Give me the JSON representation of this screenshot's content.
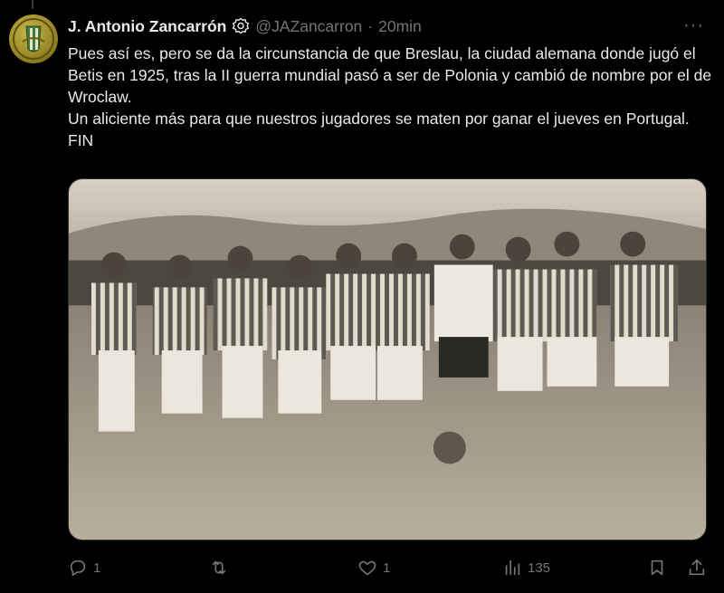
{
  "tweet": {
    "author_name": "J. Antonio Zancarrón",
    "handle": "@JAZancarron",
    "separator": "·",
    "time": "20min",
    "more": "···",
    "text_para1": "Pues así es, pero se da la circunstancia de que Breslau, la ciudad alemana donde jugó el Betis en 1925, tras la II guerra mundial pasó a ser de Polonia y cambió de nombre por el de Wroclaw.",
    "text_para2": "Un aliciente más para que nuestros jugadores se maten por ganar el jueves en Portugal. FIN"
  },
  "actions": {
    "reply_count": "1",
    "retweet_count": "",
    "like_count": "1",
    "views_count": "135"
  },
  "icons": {
    "avatar": "betis-crest-icon",
    "badge": "verified-gear-icon",
    "reply": "reply-icon",
    "retweet": "retweet-icon",
    "like": "heart-icon",
    "views": "views-bar-icon",
    "bookmark": "bookmark-icon",
    "share": "share-icon"
  },
  "colors": {
    "background": "#000000",
    "text": "#e7e9ea",
    "muted": "#71767b",
    "avatar_gold": "#b4a23a"
  }
}
